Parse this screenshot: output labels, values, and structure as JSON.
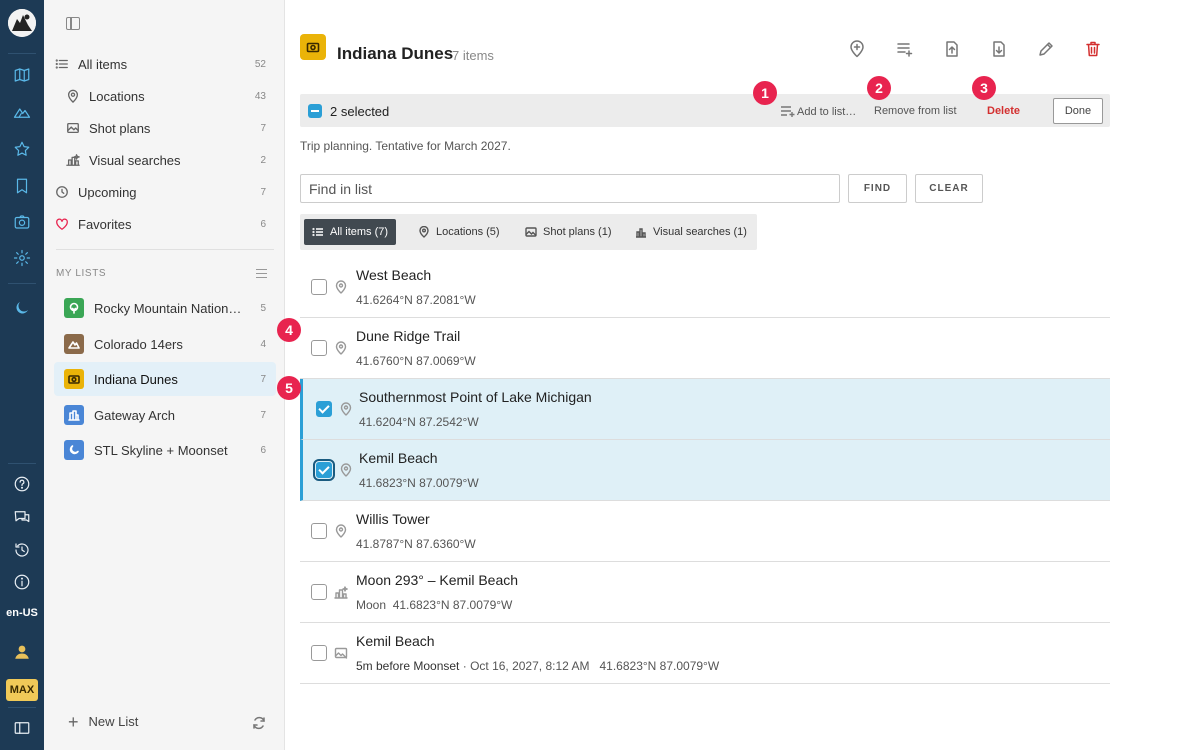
{
  "rail": {
    "locale": "en-US",
    "plan_badge": "MAX"
  },
  "sidebar": {
    "nav": [
      {
        "label": "All items",
        "count": "52"
      },
      {
        "label": "Locations",
        "count": "43"
      },
      {
        "label": "Shot plans",
        "count": "7"
      },
      {
        "label": "Visual searches",
        "count": "2"
      },
      {
        "label": "Upcoming",
        "count": "7"
      },
      {
        "label": "Favorites",
        "count": "6"
      }
    ],
    "my_lists_header": "MY LISTS",
    "lists": [
      {
        "label": "Rocky Mountain National Park",
        "count": "5",
        "color": "#3aa655"
      },
      {
        "label": "Colorado 14ers",
        "count": "4",
        "color": "#8b6a4a"
      },
      {
        "label": "Indiana Dunes",
        "count": "7",
        "color": "#eab308"
      },
      {
        "label": "Gateway Arch",
        "count": "7",
        "color": "#4a86d6"
      },
      {
        "label": "STL Skyline + Moonset",
        "count": "6",
        "color": "#4a86d6"
      }
    ],
    "new_list_label": "New List"
  },
  "header": {
    "title": "Indiana Dunes",
    "count": "7 items"
  },
  "selection": {
    "text": "2 selected",
    "add_label": "Add to list…",
    "remove_label": "Remove from list",
    "delete_label": "Delete",
    "done_label": "Done"
  },
  "callouts": [
    "1",
    "2",
    "3",
    "4",
    "5"
  ],
  "description": "Trip planning. Tentative for March 2027.",
  "search": {
    "placeholder": "Find in list",
    "find_label": "FIND",
    "clear_label": "CLEAR"
  },
  "filters": [
    {
      "label": "All items (7)"
    },
    {
      "label": "Locations (5)"
    },
    {
      "label": "Shot plans (1)"
    },
    {
      "label": "Visual searches (1)"
    }
  ],
  "items": [
    {
      "name": "West Beach",
      "prefix": "",
      "coords": "41.6264°N 87.2081°W",
      "selected": false
    },
    {
      "name": "Dune Ridge Trail",
      "prefix": "",
      "coords": "41.6760°N 87.0069°W",
      "selected": false
    },
    {
      "name": "Southernmost Point of Lake Michigan",
      "prefix": "",
      "coords": "41.6204°N 87.2542°W",
      "selected": true
    },
    {
      "name": "Kemil Beach",
      "prefix": "",
      "coords": "41.6823°N 87.0079°W",
      "selected": true
    },
    {
      "name": "Willis Tower",
      "prefix": "",
      "coords": "41.8787°N 87.6360°W",
      "selected": false
    },
    {
      "name": "Moon 293° – Kemil Beach",
      "prefix": "Moon",
      "coords": "41.6823°N 87.0079°W",
      "selected": false
    },
    {
      "name": "Kemil Beach",
      "prefix": "5m before Moonset",
      "detail": "· Oct 16, 2027, 8:12 AM",
      "coords": "41.6823°N 87.0079°W",
      "selected": false
    }
  ],
  "colors": {
    "rail_bg": "#1d3a55",
    "accent": "#2b9fd6",
    "delete": "#d32f2f",
    "callout": "#e8244f"
  }
}
